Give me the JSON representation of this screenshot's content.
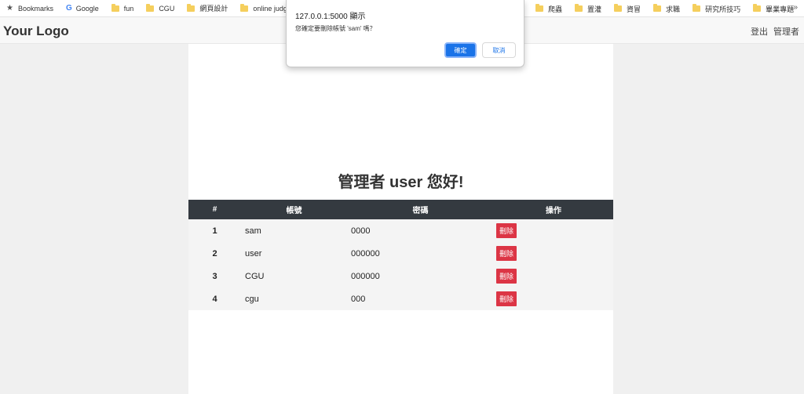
{
  "bookmarks": {
    "items": [
      {
        "label": "Bookmarks",
        "icon": "star-icon"
      },
      {
        "label": "Google",
        "icon": "google-icon"
      },
      {
        "label": "fun",
        "icon": "folder-icon"
      },
      {
        "label": "CGU",
        "icon": "folder-icon"
      },
      {
        "label": "網頁設計",
        "icon": "folder-icon"
      },
      {
        "label": "online judge",
        "icon": "folder-icon"
      },
      {
        "label": "",
        "icon": "folder-icon"
      },
      {
        "label": "爬蟲",
        "icon": "folder-icon"
      },
      {
        "label": "置灌",
        "icon": "folder-icon"
      },
      {
        "label": "資冒",
        "icon": "folder-icon"
      },
      {
        "label": "求職",
        "icon": "folder-icon"
      },
      {
        "label": "研究所技巧",
        "icon": "folder-icon"
      },
      {
        "label": "畢業專題",
        "icon": "folder-icon"
      }
    ],
    "more": "»"
  },
  "navbar": {
    "logo": "Your Logo",
    "logout": "登出",
    "admin": "管理者"
  },
  "main": {
    "greeting": "管理者 user 您好!",
    "table": {
      "headers": [
        "#",
        "帳號",
        "密碼",
        "操作"
      ],
      "rows": [
        {
          "num": "1",
          "account": "sam",
          "password": "0000",
          "action": "刪除"
        },
        {
          "num": "2",
          "account": "user",
          "password": "000000",
          "action": "刪除"
        },
        {
          "num": "3",
          "account": "CGU",
          "password": "000000",
          "action": "刪除"
        },
        {
          "num": "4",
          "account": "cgu",
          "password": "000",
          "action": "刪除"
        }
      ]
    }
  },
  "dialog": {
    "title": "127.0.0.1:5000 顯示",
    "message": "您確定要刪除帳號 'sam' 嗎？",
    "ok": "確定",
    "cancel": "取消"
  },
  "colors": {
    "table_header_bg": "#343a40",
    "delete_button": "#dc3545",
    "dialog_ok": "#1a73e8"
  }
}
